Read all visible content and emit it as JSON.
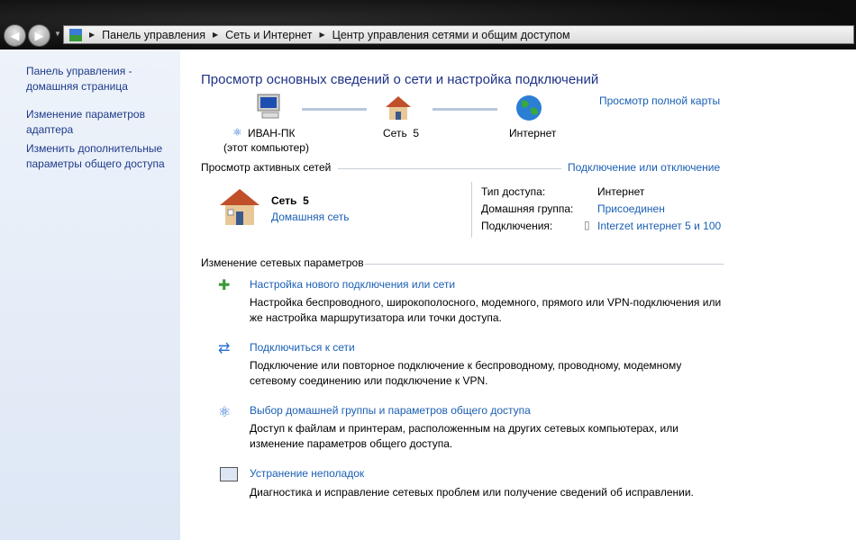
{
  "breadcrumb": [
    "Панель управления",
    "Сеть и Интернет",
    "Центр управления сетями и общим доступом"
  ],
  "sidebar": {
    "items": [
      "Панель управления - домашняя страница",
      "Изменение параметров адаптера",
      "Изменить дополнительные параметры общего доступа"
    ]
  },
  "main": {
    "title": "Просмотр основных сведений о сети и настройка подключений",
    "full_map": "Просмотр полной карты",
    "map": {
      "computer": "ИВАН-ПК",
      "computer_sub": "(этот компьютер)",
      "network": "Сеть  5",
      "internet": "Интернет"
    },
    "active_header": "Просмотр активных сетей",
    "connect_link": "Подключение или отключение",
    "network": {
      "name": "Сеть  5",
      "type": "Домашняя сеть"
    },
    "props": [
      {
        "label": "Тип доступа:",
        "value": "Интернет"
      },
      {
        "label": "Домашняя группа:",
        "value": "Присоединен"
      },
      {
        "label": "Подключения:",
        "value": "Interzet интернет 5 и 100"
      }
    ],
    "change_header": "Изменение сетевых параметров",
    "tasks": [
      {
        "title": "Настройка нового подключения или сети",
        "desc": "Настройка беспроводного, широкополосного, модемного, прямого или VPN-подключения или же настройка маршрутизатора или точки доступа."
      },
      {
        "title": "Подключиться к сети",
        "desc": "Подключение или повторное подключение к беспроводному, проводному, модемному сетевому соединению или подключение к VPN."
      },
      {
        "title": "Выбор домашней группы и параметров общего доступа",
        "desc": "Доступ к файлам и принтерам, расположенным на других сетевых компьютерах, или изменение параметров общего доступа."
      },
      {
        "title": "Устранение неполадок",
        "desc": "Диагностика и исправление сетевых проблем или получение сведений об исправлении."
      }
    ]
  }
}
